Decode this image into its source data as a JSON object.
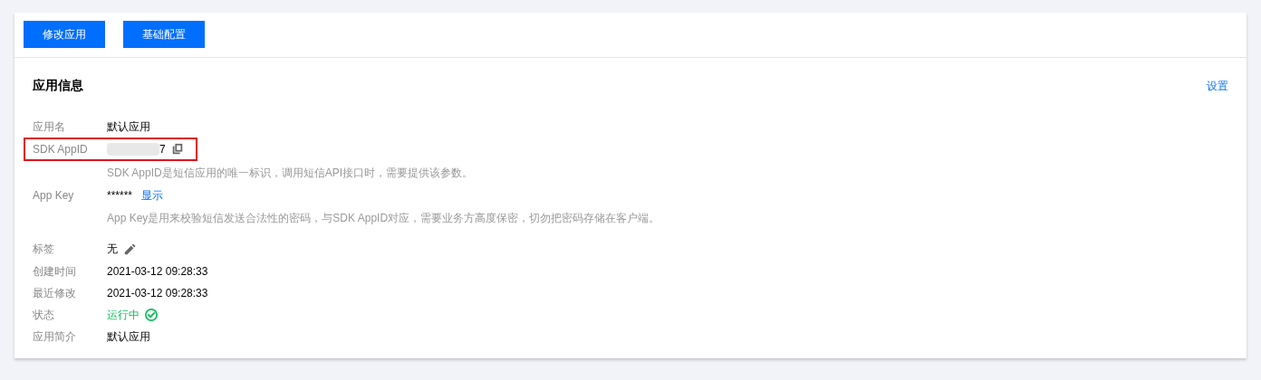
{
  "toolbar": {
    "buttons": [
      "修改应用",
      "基础配置"
    ]
  },
  "section": {
    "title": "应用信息",
    "action": "设置"
  },
  "fields": [
    {
      "kind": "text",
      "label": "应用名",
      "value": "默认应用",
      "highlighted": false
    },
    {
      "kind": "copyable",
      "label": "SDK AppID",
      "value": "7",
      "redacted": true,
      "highlighted": true,
      "hint": "SDK AppID是短信应用的唯一标识，调用短信API接口时，需要提供该参数。"
    },
    {
      "kind": "secret",
      "label": "App Key",
      "value": "******",
      "link": "显示",
      "highlighted": false,
      "hint": "App Key是用来校验短信发送合法性的密码，与SDK AppID对应，需要业务方高度保密，切勿把密码存储在客户端。"
    },
    {
      "kind": "editable",
      "label": "标签",
      "value": "无",
      "highlighted": false
    },
    {
      "kind": "text",
      "label": "创建时间",
      "value": "2021-03-12 09:28:33",
      "highlighted": false
    },
    {
      "kind": "text",
      "label": "最近修改",
      "value": "2021-03-12 09:28:33",
      "highlighted": false
    },
    {
      "kind": "status",
      "label": "状态",
      "value": "运行中",
      "color": "#0abf5b",
      "highlighted": false
    },
    {
      "kind": "text",
      "label": "应用简介",
      "value": "默认应用",
      "highlighted": false
    }
  ]
}
